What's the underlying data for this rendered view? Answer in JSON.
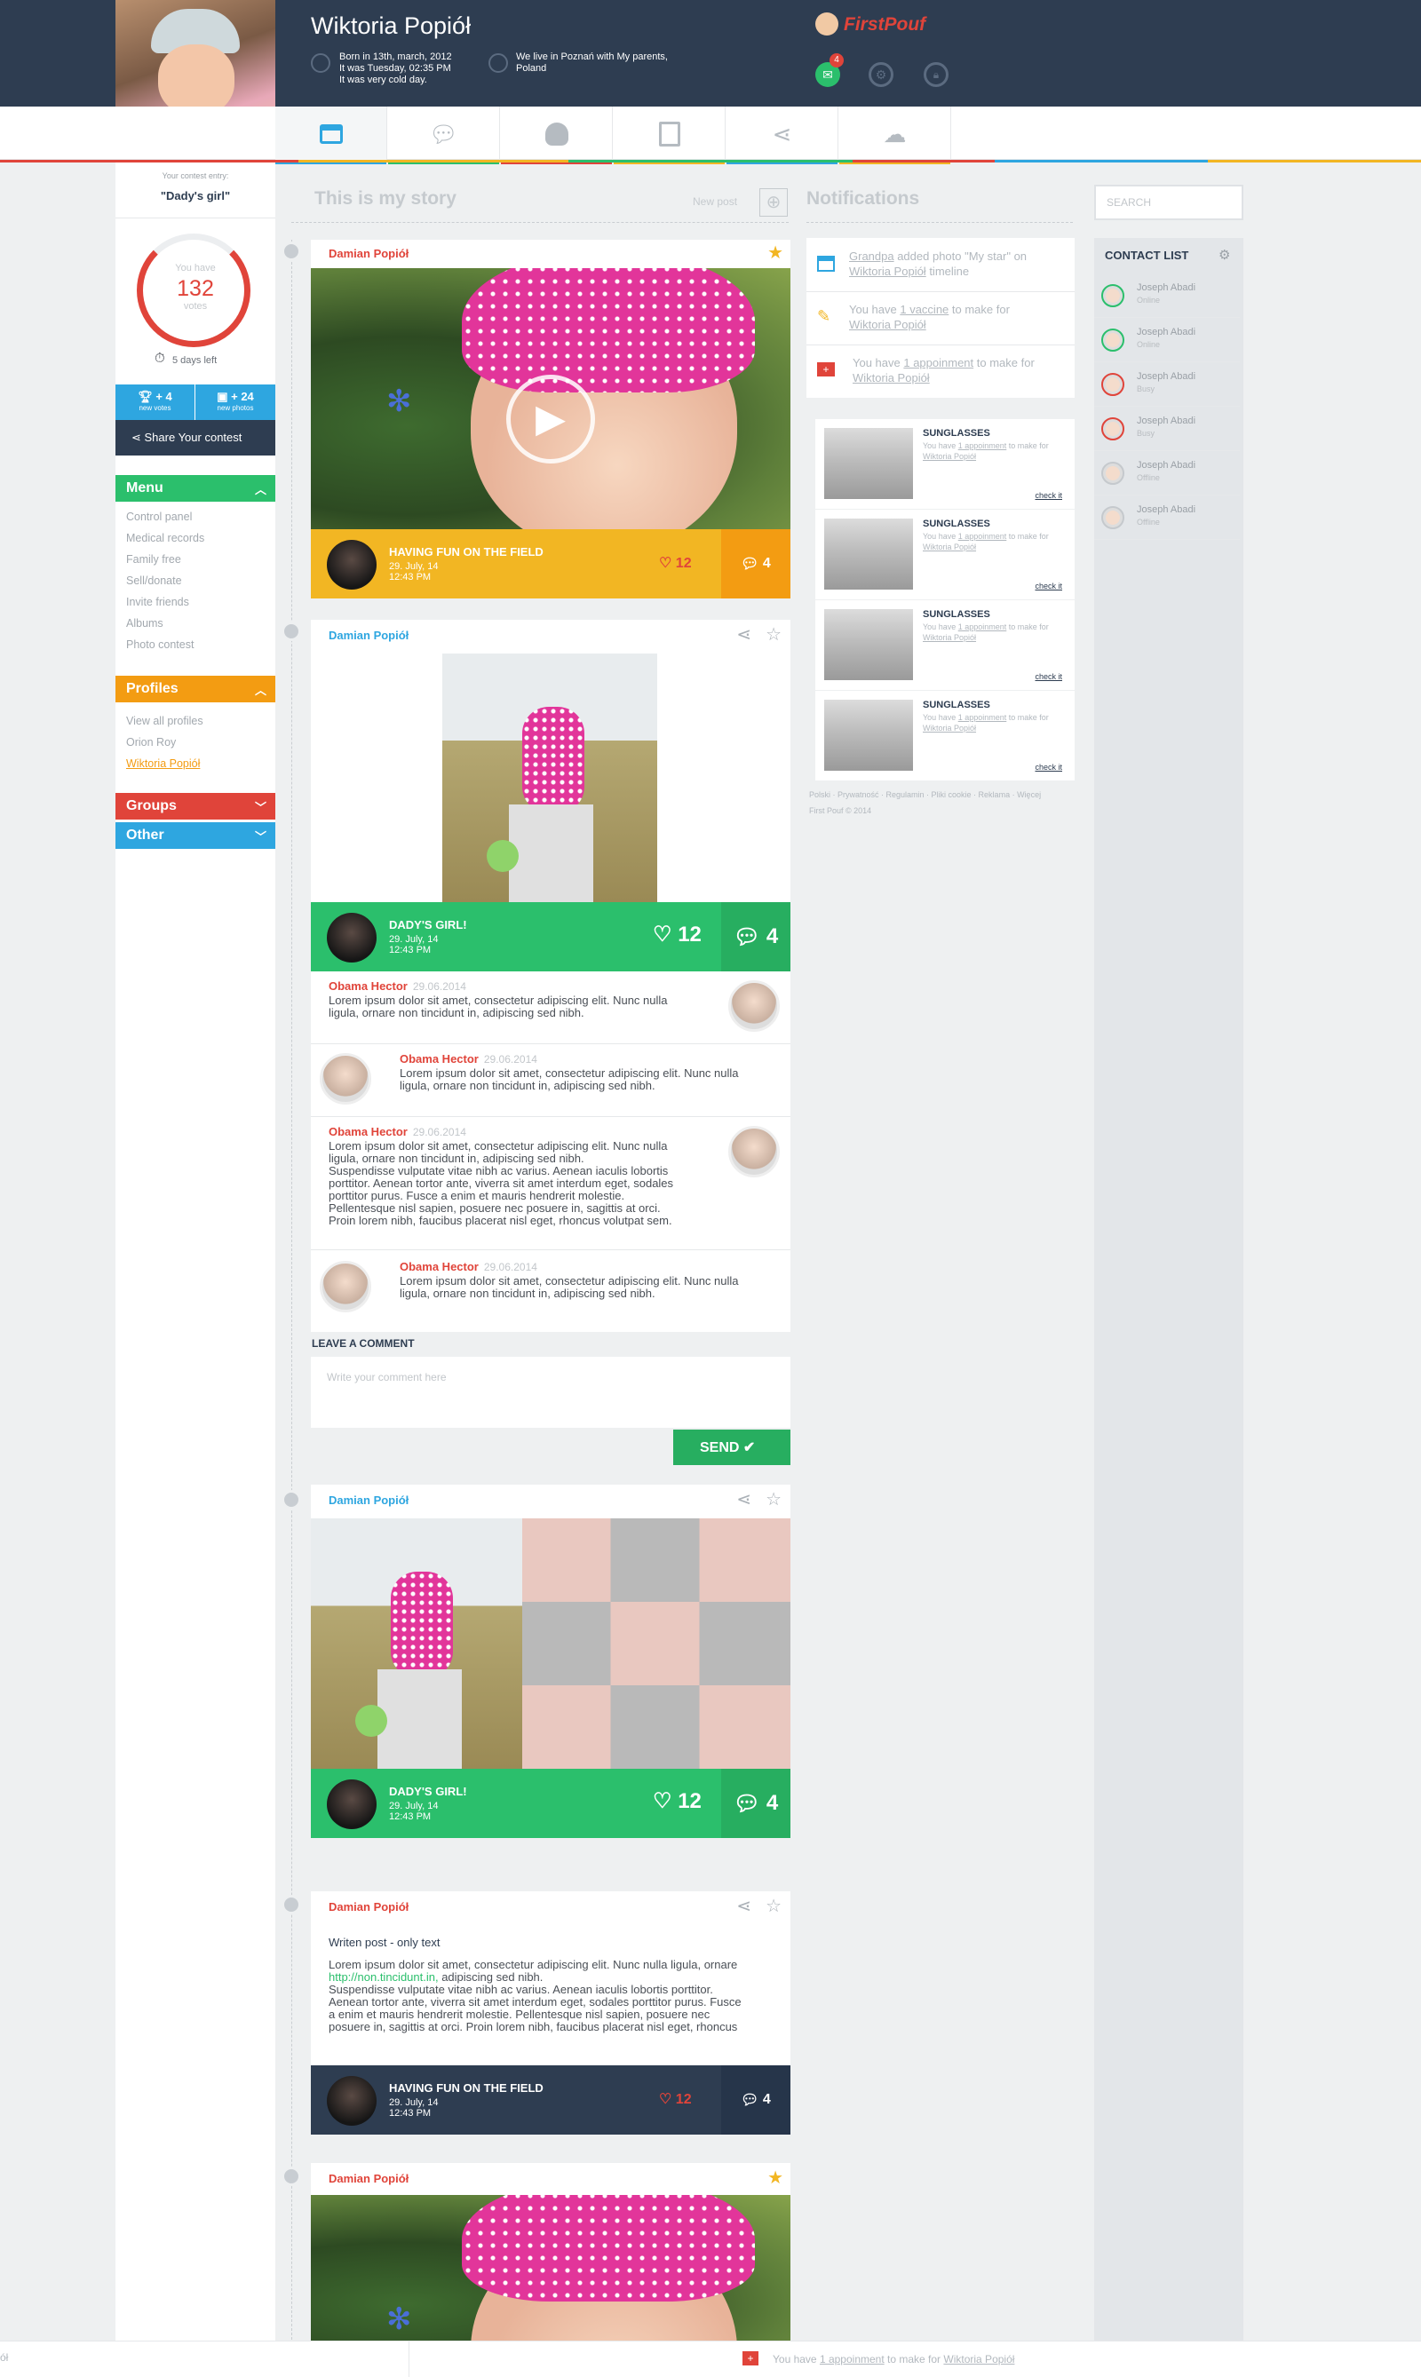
{
  "header": {
    "name": "Wiktoria Popiół",
    "born": "Born in 13th, march, 2012\nIt was Tuesday, 02:35 PM\nIt was very cold day.",
    "live": "We live in Poznań with My parents,\nPoland",
    "logo": "FirstPouf",
    "mail_count": "4"
  },
  "tabs": [
    "timeline-icon",
    "chat-icon",
    "profile-icon",
    "document-icon",
    "share-icon",
    "cloud-upload-icon"
  ],
  "left": {
    "contest_label": "Your contest entry:",
    "contest_name": "\"Dady's girl\"",
    "you_have": "You have",
    "votes": "132",
    "votes_label": "votes",
    "days_left": "5 days left",
    "new_votes": "+ 4",
    "new_votes_label": "new votes",
    "new_photos": "+ 24",
    "new_photos_label": "new photos",
    "share": "Share Your contest",
    "menu": "Menu",
    "menu_items": [
      "Control panel",
      "Medical records",
      "Family free",
      "Sell/donate",
      "Invite friends",
      "Albums",
      "Photo contest"
    ],
    "profiles": "Profiles",
    "profile_items": [
      "View all profiles",
      "Orion Roy",
      "Wiktoria Popiół"
    ],
    "groups": "Groups",
    "other": "Other"
  },
  "story": {
    "title": "This is my story",
    "new_post": "New post"
  },
  "posts": {
    "p1": {
      "author": "Damian Popiół",
      "title": "HAVING FUN ON THE FIELD",
      "date": "29. July, 14\n12:43 PM",
      "likes": "12",
      "comments": "4"
    },
    "p2": {
      "author": "Damian Popiół",
      "title": "DADY'S GIRL!",
      "date": "29. July, 14\n12:43 PM",
      "likes": "12",
      "comments": "4"
    },
    "p3": {
      "author": "Damian Popiół",
      "title": "DADY'S GIRL!",
      "date": "29. July, 14\n12:43 PM",
      "likes": "12",
      "comments": "4"
    },
    "p4": {
      "author": "Damian Popiół",
      "heading": "Writen post - only text",
      "body_a": "Lorem ipsum dolor sit amet, consectetur adipiscing elit. Nunc nulla ligula, ornare",
      "link": "http://non.tincidunt.in,",
      "body_b": " adipiscing sed nibh.\nSuspendisse vulputate vitae nibh ac varius. Aenean iaculis lobortis porttitor.\nAenean tortor ante, viverra sit amet interdum eget, sodales porttitor purus. Fusce\na enim et mauris hendrerit molestie. Pellentesque nisl sapien, posuere nec\nposuere in, sagittis at orci. Proin lorem nibh, faucibus placerat nisl eget, rhoncus",
      "title": "HAVING FUN ON THE FIELD",
      "date": "29. July, 14\n12:43 PM",
      "likes": "12",
      "comments": "4"
    },
    "p5": {
      "author": "Damian Popiół"
    }
  },
  "comments": [
    {
      "name": "Obama Hector",
      "date": "29.06.2014",
      "text": "Lorem ipsum dolor sit amet, consectetur adipiscing elit. Nunc nulla\nligula, ornare non tincidunt in, adipiscing sed nibh."
    },
    {
      "name": "Obama Hector",
      "date": "29.06.2014",
      "text": "Lorem ipsum dolor sit amet, consectetur adipiscing elit. Nunc nulla\nligula, ornare non tincidunt in, adipiscing sed nibh."
    },
    {
      "name": "Obama Hector",
      "date": "29.06.2014",
      "text": "Lorem ipsum dolor sit amet, consectetur adipiscing elit. Nunc nulla\nligula, ornare non tincidunt in, adipiscing sed nibh.\nSuspendisse vulputate vitae nibh ac varius. Aenean iaculis lobortis\nporttitor. Aenean tortor ante, viverra sit amet interdum eget, sodales\nporttitor purus. Fusce a enim et mauris hendrerit molestie.\nPellentesque nisl sapien, posuere nec posuere in, sagittis at orci.\nProin lorem nibh, faucibus placerat nisl eget, rhoncus volutpat sem."
    },
    {
      "name": "Obama Hector",
      "date": "29.06.2014",
      "text": "Lorem ipsum dolor sit amet, consectetur adipiscing elit. Nunc nulla\nligula, ornare non tincidunt in, adipiscing sed nibh."
    }
  ],
  "leave_comment": "LEAVE A COMMENT",
  "comment_placeholder": "Write your comment here",
  "send": "SEND",
  "notifications": {
    "title": "Notifications",
    "items": [
      {
        "pre": "",
        "link": "Grandpa",
        "mid": " added photo \"My star\" on",
        "link2": "Wiktoria Popiół",
        "post": " timeline"
      },
      {
        "pre": "You have ",
        "link": "1 vaccine",
        "mid": " to make for",
        "link2": "Wiktoria Popiół",
        "post": ""
      },
      {
        "pre": "You have ",
        "link": "1 appoinment",
        "mid": " to make for",
        "link2": "Wiktoria Popiół",
        "post": ""
      }
    ],
    "sg_title": "SUNGLASSES",
    "sg_pre": "You have ",
    "sg_link": "1 appoinment",
    "sg_mid": " to make for",
    "sg_link2": "Wiktoria Popiół",
    "sg_check": "check it",
    "footer": "Polski · Prywatność · Regulamin · Pliki cookie · Reklama · Więcej\nFirst Pouf © 2014"
  },
  "search": {
    "placeholder": "SEARCH"
  },
  "contacts": {
    "title": "CONTACT LIST",
    "items": [
      {
        "name": "Joseph Abadi",
        "status": "Online",
        "color": "#2bbf6c"
      },
      {
        "name": "Joseph Abadi",
        "status": "Online",
        "color": "#2bbf6c"
      },
      {
        "name": "Joseph Abadi",
        "status": "Busy",
        "color": "#e0443a"
      },
      {
        "name": "Joseph Abadi",
        "status": "Busy",
        "color": "#e0443a"
      },
      {
        "name": "Joseph Abadi",
        "status": "Offline",
        "color": "#c5c9cd"
      },
      {
        "name": "Joseph Abadi",
        "status": "Offline",
        "color": "#c5c9cd"
      }
    ]
  },
  "bottom_notif": {
    "pre": "You have ",
    "link": "1 appoinment",
    "mid": " to make for ",
    "link2": "Wiktoria Popiół"
  },
  "bottom_left": "ół",
  "colors": {
    "navy": "#2e3d51",
    "red": "#e0443a",
    "green": "#2bbf6c",
    "yellow": "#f2b623",
    "orange": "#f39c12",
    "blue": "#2ea6e0"
  }
}
